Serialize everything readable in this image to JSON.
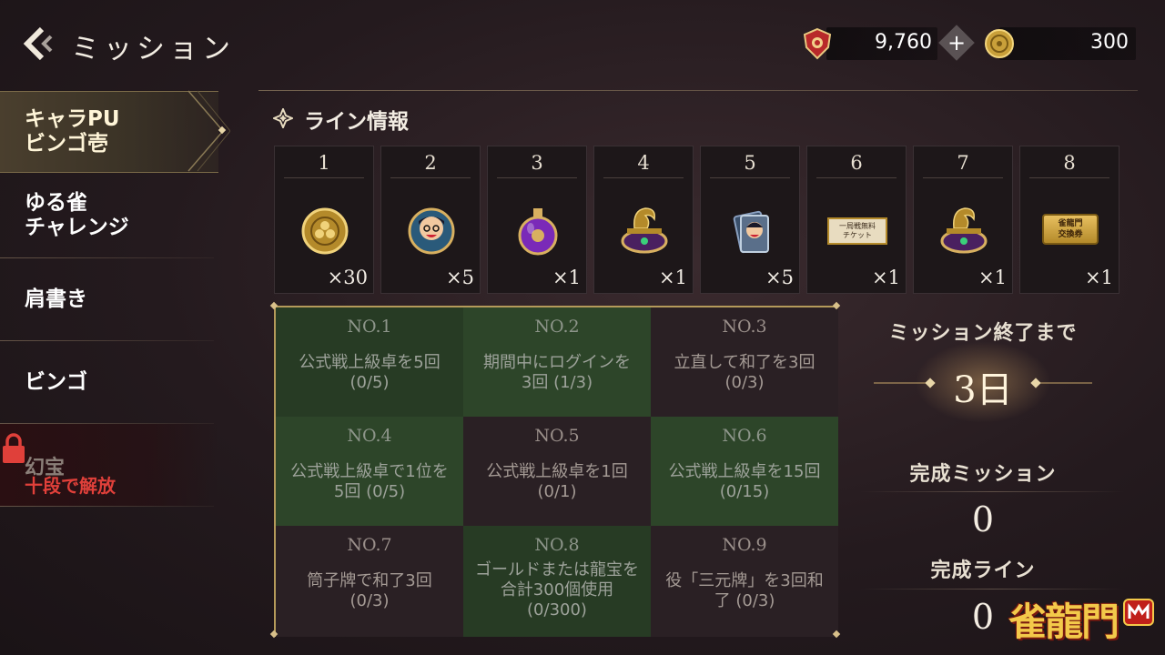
{
  "header": {
    "title": "ミッション",
    "currencies": [
      {
        "icon": "red-gem-shield-icon",
        "value": "9,760"
      },
      {
        "icon": "gold-coin-icon",
        "value": "300"
      }
    ]
  },
  "sidebar": {
    "items": [
      {
        "label": "キャラPU\nビンゴ壱"
      },
      {
        "label": "ゆる雀\nチャレンジ"
      },
      {
        "label": "肩書き"
      },
      {
        "label": "ビンゴ"
      }
    ],
    "locked": {
      "label": "幻宝",
      "note": "十段で解放"
    }
  },
  "section": {
    "title": "ライン情報"
  },
  "line_rewards": [
    {
      "num": "1",
      "qty": "×30",
      "icon": "gold-coin-icon"
    },
    {
      "num": "2",
      "qty": "×5",
      "icon": "character-medal-icon"
    },
    {
      "num": "3",
      "qty": "×1",
      "icon": "purple-potion-icon"
    },
    {
      "num": "4",
      "qty": "×1",
      "icon": "dragon-treasure-icon"
    },
    {
      "num": "5",
      "qty": "×5",
      "icon": "character-card-icon"
    },
    {
      "num": "6",
      "qty": "×1",
      "icon": "free-match-ticket-icon",
      "ticket_text": "一局戦無料\nチケット"
    },
    {
      "num": "7",
      "qty": "×1",
      "icon": "dragon-treasure-icon"
    },
    {
      "num": "8",
      "qty": "×1",
      "icon": "exchange-voucher-icon",
      "ticket_text": "雀龍門\n交換券"
    }
  ],
  "bingo": [
    {
      "no": "NO.1",
      "text": "公式戦上級卓を5回\n(0/5)"
    },
    {
      "no": "NO.2",
      "text": "期間中にログインを\n3回 (1/3)"
    },
    {
      "no": "NO.3",
      "text": "立直して和了を3回\n(0/3)"
    },
    {
      "no": "NO.4",
      "text": "公式戦上級卓で1位を\n5回 (0/5)"
    },
    {
      "no": "NO.5",
      "text": "公式戦上級卓を1回\n(0/1)"
    },
    {
      "no": "NO.6",
      "text": "公式戦上級卓を15回\n(0/15)"
    },
    {
      "no": "NO.7",
      "text": "筒子牌で和了3回\n(0/3)"
    },
    {
      "no": "NO.8",
      "text": "ゴールドまたは龍宝を\n合計300個使用\n(0/300)"
    },
    {
      "no": "NO.9",
      "text": "役「三元牌」を3回和\n了 (0/3)"
    }
  ],
  "status": {
    "remaining_label": "ミッション終了まで",
    "remaining_value": "3日",
    "completed_missions_label": "完成ミッション",
    "completed_missions_value": "0",
    "completed_lines_label": "完成ライン",
    "completed_lines_value": "0"
  },
  "logo": {
    "text": "雀龍門"
  },
  "colors": {
    "accent_gold": "#b49a5a",
    "cell_green": "#2d4529",
    "locked_red": "#e0403a"
  }
}
